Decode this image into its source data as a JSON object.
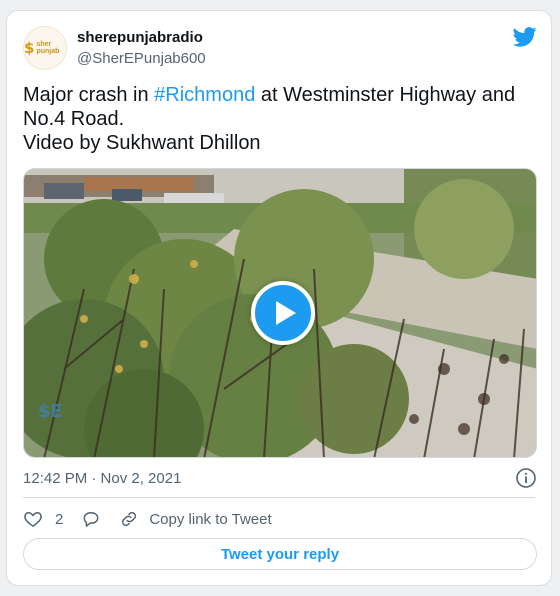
{
  "author": {
    "name": "sherepunjabradio",
    "handle": "@SherEPunjab600",
    "avatar_text": "sher punjab",
    "avatar_mark": "$"
  },
  "tweet": {
    "text_before_hashtag": "Major crash in ",
    "hashtag": "#Richmond",
    "text_after_hashtag": " at Westminster Highway and",
    "line2": "No.4 Road.",
    "line3": "Video by Sukhwant Dhillon"
  },
  "media": {
    "type": "video",
    "description_icon": "play-icon",
    "watermark": "$E"
  },
  "meta": {
    "timestamp": "12:42 PM · Nov 2, 2021"
  },
  "actions": {
    "like_count": "2",
    "copy_link_label": "Copy link to Tweet",
    "reply_button_label": "Tweet your reply"
  },
  "colors": {
    "accent": "#1d9bf0",
    "text": "#0f1419",
    "secondary_text": "#536471",
    "border": "#cfd9de"
  }
}
